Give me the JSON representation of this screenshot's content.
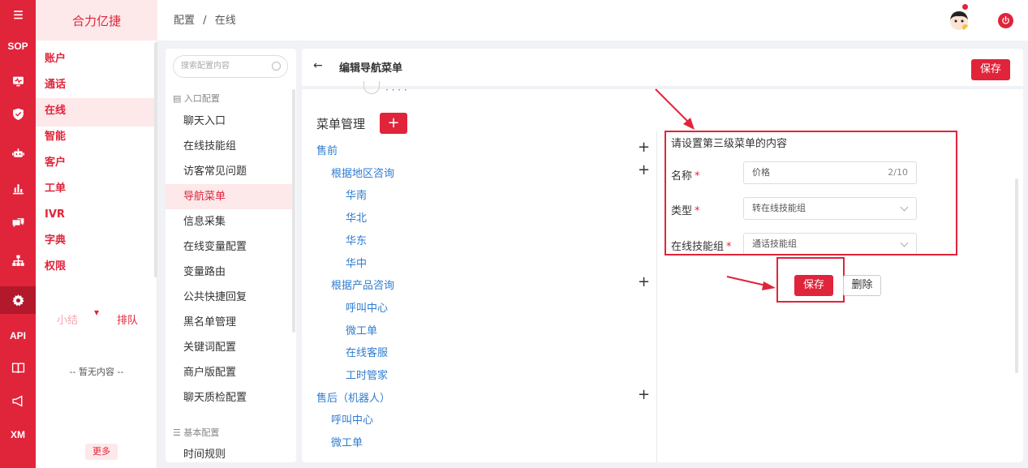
{
  "rail": {
    "items": [
      {
        "kind": "icon",
        "icon": "menu-icon"
      },
      {
        "kind": "text",
        "label": "SOP"
      },
      {
        "kind": "icon",
        "icon": "monitor-icon"
      },
      {
        "kind": "icon",
        "icon": "shield-icon"
      },
      {
        "kind": "icon",
        "icon": "robot-icon"
      },
      {
        "kind": "icon",
        "icon": "bar-chart-icon"
      },
      {
        "kind": "icon",
        "icon": "chat-icon"
      },
      {
        "kind": "icon",
        "icon": "org-icon"
      },
      {
        "kind": "icon",
        "icon": "gear-icon",
        "active": true
      },
      {
        "kind": "text",
        "label": "API"
      },
      {
        "kind": "icon",
        "icon": "book-icon"
      },
      {
        "kind": "icon",
        "icon": "megaphone-icon"
      },
      {
        "kind": "text",
        "label": "XM"
      }
    ]
  },
  "module": {
    "brand": "合力亿捷",
    "items": [
      "账户",
      "通话",
      "在线",
      "智能",
      "客户",
      "工单",
      "IVR",
      "字典",
      "权限"
    ],
    "active_index": 2,
    "tab_summary": "小结",
    "tab_queue": "排队",
    "empty_text": "-- 暂无内容 --",
    "more_label": "更多"
  },
  "header": {
    "breadcrumb": [
      "配置",
      "/",
      "在线"
    ]
  },
  "confnav": {
    "search_placeholder": "搜索配置内容",
    "group1_title": "入口配置",
    "items": [
      "聊天入口",
      "在线技能组",
      "访客常见问题",
      "导航菜单",
      "信息采集",
      "在线变量配置",
      "变量路由",
      "公共快捷回复",
      "黑名单管理",
      "关键词配置",
      "商户版配置",
      "聊天质检配置"
    ],
    "active_index": 3,
    "group2_title": "基本配置",
    "group2_items": [
      "时间规则"
    ]
  },
  "main": {
    "title": "编辑导航菜单",
    "save_label": "保存",
    "menu_heading": "菜单管理",
    "add_label": "+",
    "tree": [
      {
        "label": "售前",
        "level": 1,
        "plus": true
      },
      {
        "label": "根据地区咨询",
        "level": 2,
        "plus": true
      },
      {
        "label": "华南",
        "level": 3
      },
      {
        "label": "华北",
        "level": 3
      },
      {
        "label": "华东",
        "level": 3
      },
      {
        "label": "华中",
        "level": 3
      },
      {
        "label": "根据产品咨询",
        "level": 2,
        "plus": true
      },
      {
        "label": "呼叫中心",
        "level": 3
      },
      {
        "label": "微工单",
        "level": 3
      },
      {
        "label": "在线客服",
        "level": 3
      },
      {
        "label": "工时管家",
        "level": 3
      },
      {
        "label": "售后（机器人）",
        "level": 1,
        "plus": true
      },
      {
        "label": "呼叫中心",
        "level": 2
      },
      {
        "label": "微工单",
        "level": 2
      }
    ],
    "form": {
      "hint": "请设置第三级菜单的内容",
      "name_label": "名称",
      "name_value": "价格",
      "name_counter": "2/10",
      "type_label": "类型",
      "type_value": "转在线技能组",
      "group_label": "在线技能组",
      "group_value": "通话技能组",
      "required_mark": "*",
      "save_label": "保存",
      "delete_label": "删除"
    }
  },
  "colors": {
    "accent": "#e0243a",
    "link": "#2f7ccf"
  }
}
